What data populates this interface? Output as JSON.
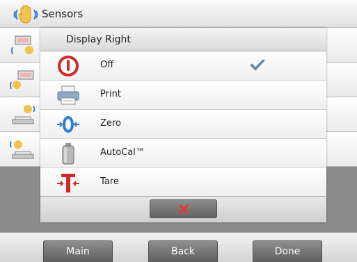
{
  "background_screen": {
    "title": "Sensors",
    "title_icon": "hand-sensor-icon",
    "rows": [
      {
        "icon": "sensor-config-icon"
      },
      {
        "icon": "sensor-config-icon"
      },
      {
        "icon": "scale-sensor-icon"
      },
      {
        "icon": "scale-sensor-icon"
      }
    ]
  },
  "dialog": {
    "title": "Display Right",
    "options": [
      {
        "label": "Off",
        "icon": "power-off-icon",
        "selected": true
      },
      {
        "label": "Print",
        "icon": "printer-icon",
        "selected": false
      },
      {
        "label": "Zero",
        "icon": "zero-icon",
        "selected": false
      },
      {
        "label": "AutoCal™",
        "icon": "calibration-weight-icon",
        "selected": false
      },
      {
        "label": "Tare",
        "icon": "tare-icon",
        "selected": false
      }
    ],
    "cancel_icon": "close-icon"
  },
  "bottom_buttons": {
    "main": "Main",
    "back": "Back",
    "done": "Done"
  },
  "colors": {
    "accent_red": "#d12a2a",
    "zero_blue": "#2f7fd0",
    "checkmark": "#6f8fb8"
  }
}
